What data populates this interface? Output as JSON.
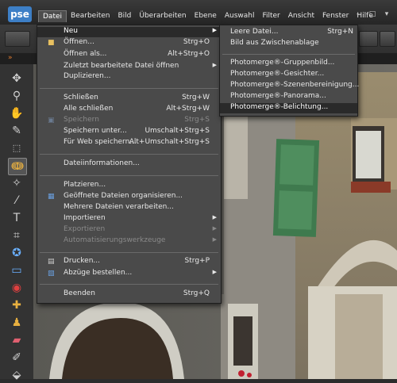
{
  "app": {
    "logo": "pse"
  },
  "menubar": {
    "items": [
      "Datei",
      "Bearbeiten",
      "Bild",
      "Überarbeiten",
      "Ebene",
      "Auswahl",
      "Filter",
      "Ansicht",
      "Fenster",
      "Hilfe"
    ]
  },
  "window": {
    "minimize": "–",
    "maximize": "□",
    "close": "▾"
  },
  "datei_menu": {
    "items": [
      {
        "label": "Neu",
        "shortcut": "",
        "arrow": "▶",
        "icon": ""
      },
      {
        "label": "Öffnen...",
        "shortcut": "Strg+O",
        "icon": "folder-icon"
      },
      {
        "label": "Öffnen als...",
        "shortcut": "Alt+Strg+O"
      },
      {
        "label": "Zuletzt bearbeitete Datei öffnen",
        "shortcut": "",
        "arrow": "▶"
      },
      {
        "label": "Duplizieren..."
      },
      {
        "label": "Schließen",
        "shortcut": "Strg+W"
      },
      {
        "label": "Alle schließen",
        "shortcut": "Alt+Strg+W"
      },
      {
        "label": "Speichern",
        "shortcut": "Strg+S"
      },
      {
        "label": "Speichern unter...",
        "shortcut": "Umschalt+Strg+S"
      },
      {
        "label": "Für Web speichern...",
        "shortcut": "Alt+Umschalt+Strg+S"
      },
      {
        "label": "Dateiinformationen..."
      },
      {
        "label": "Platzieren..."
      },
      {
        "label": "Geöffnete Dateien organisieren..."
      },
      {
        "label": "Mehrere Dateien verarbeiten..."
      },
      {
        "label": "Importieren",
        "arrow": "▶"
      },
      {
        "label": "Exportieren",
        "arrow": "▶"
      },
      {
        "label": "Automatisierungswerkzeuge",
        "arrow": "▶"
      },
      {
        "label": "Drucken...",
        "shortcut": "Strg+P"
      },
      {
        "label": "Abzüge bestellen...",
        "arrow": "▶"
      },
      {
        "label": "Beenden",
        "shortcut": "Strg+Q"
      }
    ]
  },
  "neu_submenu": {
    "items": [
      {
        "label": "Leere Datei...",
        "shortcut": "Strg+N"
      },
      {
        "label": "Bild aus Zwischenablage"
      },
      {
        "label": "Photomerge®-Gruppenbild..."
      },
      {
        "label": "Photomerge®-Gesichter..."
      },
      {
        "label": "Photomerge®-Szenenbereinigung..."
      },
      {
        "label": "Photomerge®-Panorama..."
      },
      {
        "label": "Photomerge®-Belichtung..."
      }
    ]
  },
  "colors": {
    "accent": "#3d7fc6",
    "menu_bg": "#4a4a4a",
    "highlight": "#2a2a2a"
  }
}
